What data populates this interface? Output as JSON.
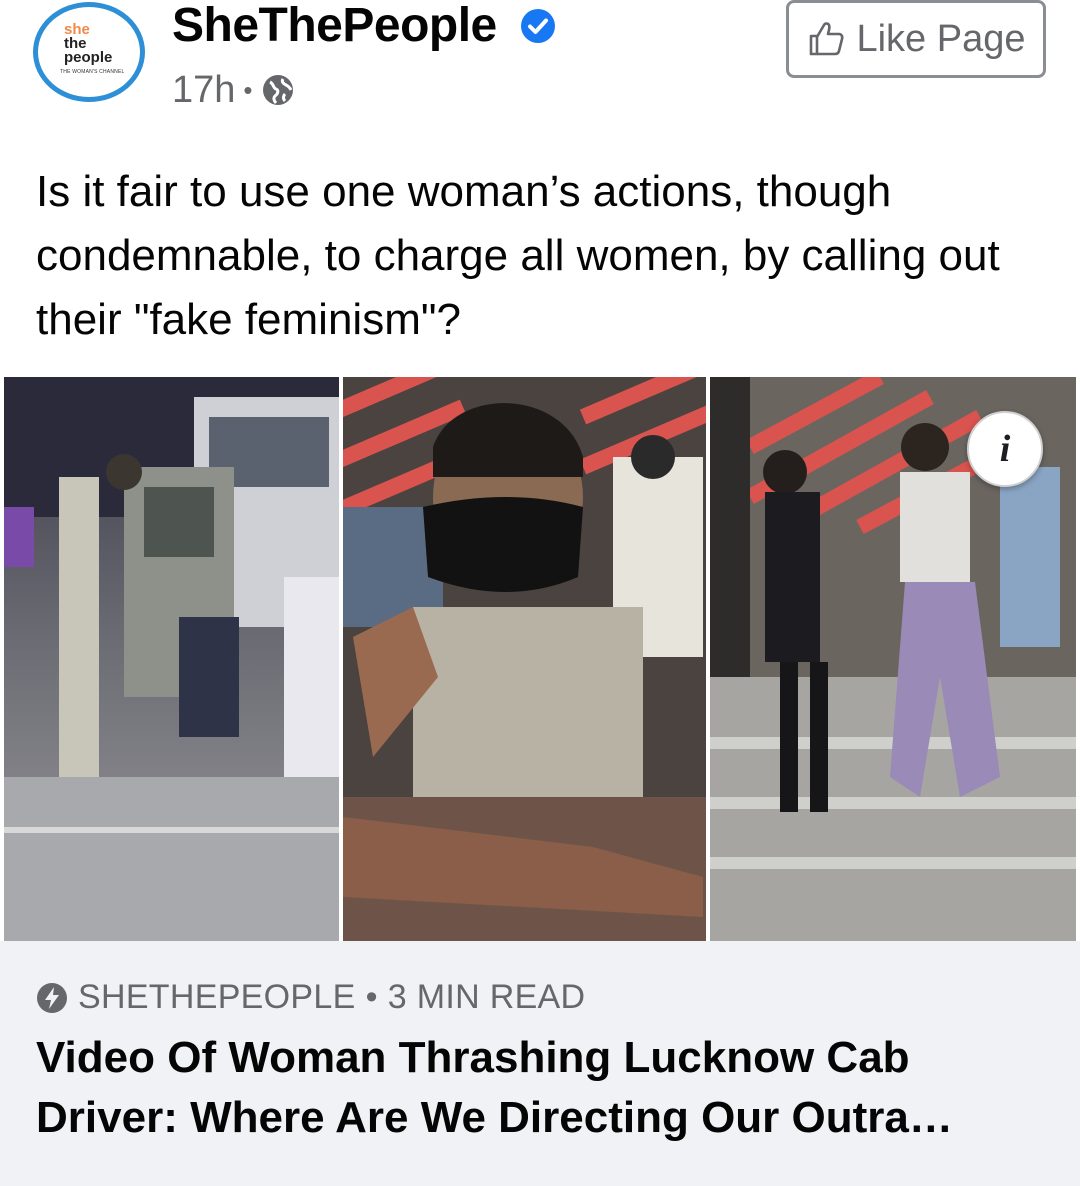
{
  "header": {
    "avatar_lines": [
      "she",
      "the",
      "people",
      "THE WOMAN'S CHANNEL"
    ],
    "page_name": "SheThePeople",
    "verified_icon": "verified-badge-icon",
    "time": "17h",
    "separator": "•",
    "privacy_icon": "globe-icon",
    "like_button_label": "Like Page",
    "like_icon": "thumbs-up-icon"
  },
  "post": {
    "text": "Is it fair to use one woman’s actions, though condemnable, to charge all women, by calling out their \"fake feminism\"?"
  },
  "media": {
    "info_button_label": "i"
  },
  "link_card": {
    "source_icon": "instant-article-bolt-icon",
    "source": "SHETHEPEOPLE",
    "separator": "•",
    "read_time": "3 MIN READ",
    "title": "Video Of Woman Thrashing Lucknow Cab Driver: Where Are We Directing Our Outra…"
  },
  "colors": {
    "brand_blue": "#2d8fd6",
    "verified_blue": "#1877f2",
    "meta_gray": "#65676b",
    "card_bg": "#f0f2f5",
    "avatar_orange": "#f08a4b"
  }
}
